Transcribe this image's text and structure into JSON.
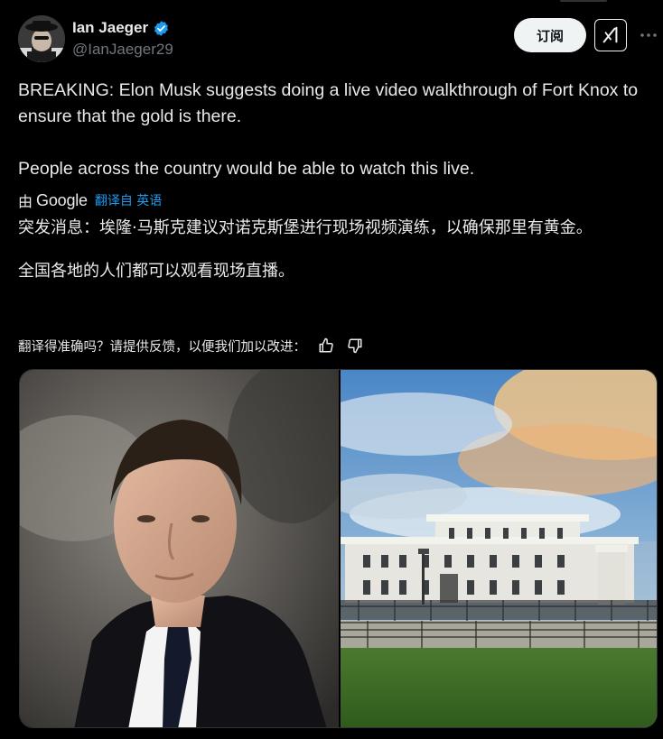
{
  "author": {
    "display_name": "Ian Jaeger",
    "handle": "@IanJaeger29",
    "verified": true
  },
  "actions": {
    "subscribe_label": "订阅",
    "grok_icon": "grok-icon",
    "more_icon": "more-icon"
  },
  "tweet": {
    "paragraphs": [
      "BREAKING: Elon Musk suggests doing a live video walkthrough of Fort Knox to ensure that the gold is there.",
      "People across the country would be able to watch this live."
    ]
  },
  "translation": {
    "by_label": "由",
    "provider": "Google",
    "translated_from": "翻译自 英语",
    "paragraphs": [
      "突发消息：埃隆·马斯克建议对诺克斯堡进行现场视频演练，以确保那里有黄金。",
      "全国各地的人们都可以观看现场直播。"
    ],
    "feedback_prompt": "翻译得准确吗？请提供反馈，以便我们加以改进：",
    "thumbs_up_icon": "thumbs-up-icon",
    "thumbs_down_icon": "thumbs-down-icon"
  },
  "media": {
    "items": [
      "photo-portrait",
      "photo-building"
    ]
  },
  "colors": {
    "background": "#000000",
    "text": "#e7e9ea",
    "secondary": "#71767b",
    "accent": "#1d9bf0",
    "button_bg": "#eff3f4"
  }
}
